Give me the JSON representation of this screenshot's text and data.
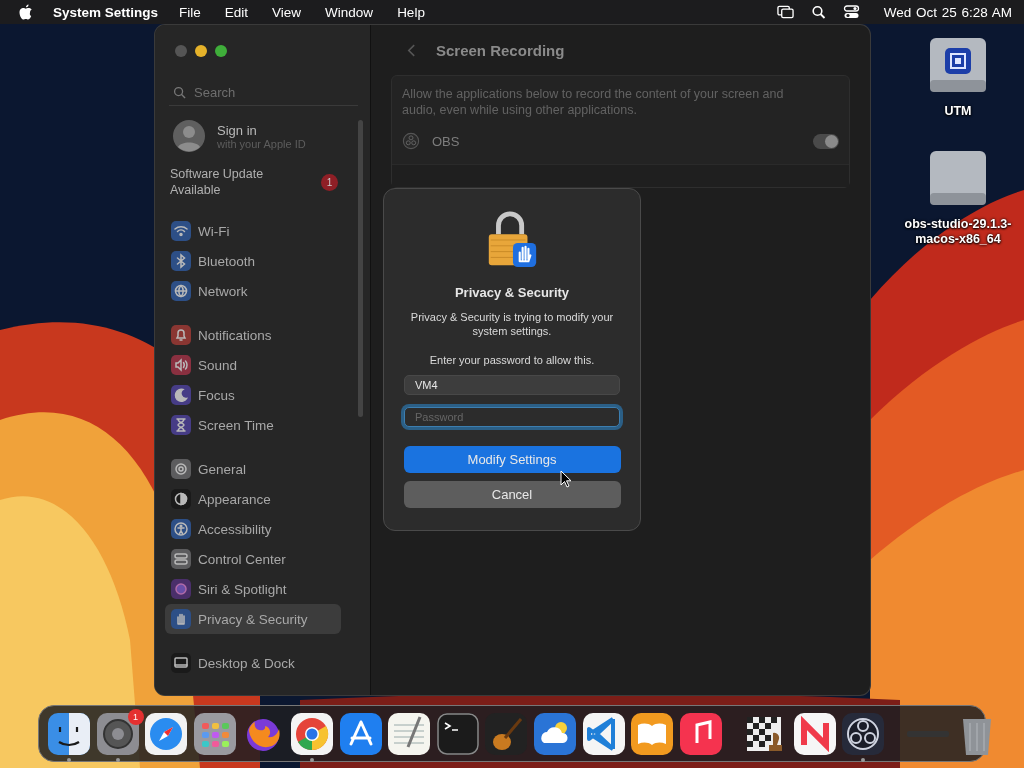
{
  "menubar": {
    "app": "System Settings",
    "menus": [
      "File",
      "Edit",
      "View",
      "Window",
      "Help"
    ],
    "clock": "Wed Oct 25  6:28 AM"
  },
  "sidebar": {
    "search": {
      "placeholder": "Search"
    },
    "account": {
      "title": "Sign in",
      "subtitle": "with your Apple ID"
    },
    "update": {
      "label": "Software Update Available",
      "badge": "1"
    },
    "groups": [
      [
        {
          "label": "Wi-Fi",
          "color": "#2d4f86",
          "selected": false
        },
        {
          "label": "Bluetooth",
          "color": "#2d4f86",
          "selected": false
        },
        {
          "label": "Network",
          "color": "#2d4f86",
          "selected": false
        }
      ],
      [
        {
          "label": "Notifications",
          "color": "#8a3632",
          "selected": false
        },
        {
          "label": "Sound",
          "color": "#8a3040",
          "selected": false
        },
        {
          "label": "Focus",
          "color": "#463c86",
          "selected": false
        },
        {
          "label": "Screen Time",
          "color": "#463c86",
          "selected": false
        }
      ],
      [
        {
          "label": "General",
          "color": "#5c5c5e",
          "selected": false
        },
        {
          "label": "Appearance",
          "color": "#1a1a1a",
          "selected": false
        },
        {
          "label": "Accessibility",
          "color": "#2d4f86",
          "selected": false
        },
        {
          "label": "Control Center",
          "color": "#5c5c5e",
          "selected": false
        },
        {
          "label": "Siri & Spotlight",
          "color": "#4a2f6a",
          "selected": false
        },
        {
          "label": "Privacy & Security",
          "color": "#2d4f86",
          "selected": true
        }
      ],
      [
        {
          "label": "Desktop & Dock",
          "color": "#1a1a1a",
          "selected": false
        }
      ]
    ]
  },
  "content": {
    "title": "Screen Recording",
    "description": "Allow the applications below to record the content of your screen and audio, even while using other applications.",
    "apps": [
      {
        "name": "OBS",
        "on": true
      }
    ]
  },
  "dialog": {
    "title": "Privacy & Security",
    "message": "Privacy & Security is trying to modify your system settings.",
    "prompt": "Enter your password to allow this.",
    "username": "VM4",
    "password": {
      "placeholder": "Password",
      "focused": true
    },
    "buttons": [
      {
        "label": "Modify Settings",
        "kind": "primary"
      },
      {
        "label": "Cancel",
        "kind": "secondary"
      }
    ]
  },
  "desktop_icons": [
    {
      "lines": [
        "UTM"
      ],
      "kind": "utm"
    },
    {
      "lines": [
        "obs-studio-29.1.3-",
        "macos-x86_64"
      ],
      "kind": "plain"
    }
  ],
  "dock": [
    [
      {
        "kind": "finder",
        "running": true
      },
      {
        "kind": "settings",
        "running": true,
        "badge": "1"
      },
      {
        "kind": "safari",
        "running": false
      },
      {
        "kind": "launchpad",
        "running": false
      },
      {
        "kind": "firefox",
        "running": false
      },
      {
        "kind": "chrome",
        "running": true
      },
      {
        "kind": "appstore",
        "running": false
      },
      {
        "kind": "textedit",
        "running": false
      },
      {
        "kind": "terminal",
        "running": false
      },
      {
        "kind": "garageband",
        "running": false
      },
      {
        "kind": "weather",
        "running": false
      },
      {
        "kind": "vscode",
        "running": false
      },
      {
        "kind": "books",
        "running": false
      },
      {
        "kind": "music",
        "running": false
      }
    ],
    [
      {
        "kind": "chess",
        "running": false
      },
      {
        "kind": "news",
        "running": false
      },
      {
        "kind": "obs",
        "running": true
      }
    ],
    [
      {
        "kind": "window",
        "running": false
      },
      {
        "kind": "trash",
        "running": false
      }
    ]
  ]
}
